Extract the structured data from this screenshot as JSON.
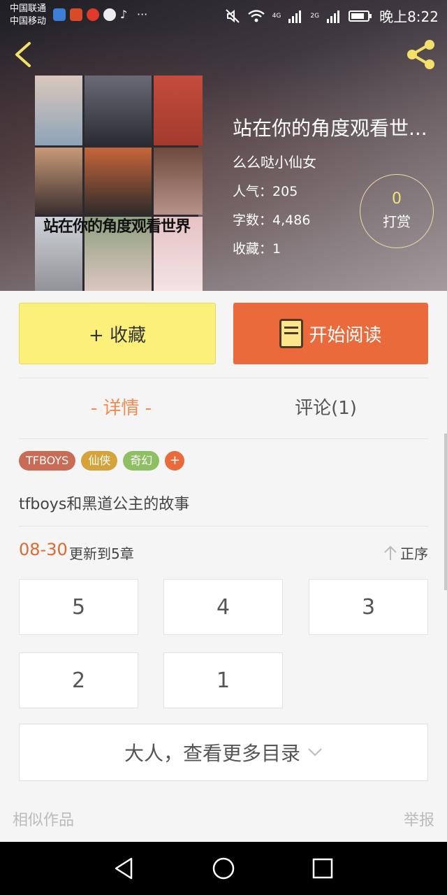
{
  "status_bar": {
    "carrier_1": "中国联通",
    "carrier_2": "中国移动",
    "more_dots": "···",
    "network_1": "4G",
    "network_2": "2G",
    "time": "晚上8:22"
  },
  "book": {
    "cover_title": "站在你的角度观看世界",
    "title": "站在你的角度观看世...",
    "author": "么么哒小仙女",
    "popularity_label": "人气：",
    "popularity_value": "205",
    "words_label": "字数：",
    "words_value": "4,486",
    "favorites_label": "收藏：",
    "favorites_value": "1",
    "tip_count": "0",
    "tip_label": "打赏"
  },
  "actions": {
    "collect_label": "+ 收藏",
    "read_label": "开始阅读"
  },
  "tabs": [
    {
      "label": "- 详情 -",
      "active": true
    },
    {
      "label": "评论(1)",
      "active": false
    }
  ],
  "tags": [
    {
      "label": "TFBOYS",
      "color": "#c96b55"
    },
    {
      "label": "仙侠",
      "color": "#d6a23a"
    },
    {
      "label": "奇幻",
      "color": "#8fbf63"
    }
  ],
  "tag_add": "+",
  "description": "tfboys和黑道公主的故事",
  "update": {
    "date": "08-30",
    "text": "更新到5章",
    "sort_label": "正序"
  },
  "chapters": [
    "5",
    "4",
    "3",
    "2",
    "1"
  ],
  "more_label": "大人，查看更多目录",
  "footer": {
    "similar": "相似作品",
    "report": "举报"
  },
  "colors": {
    "accent": "#ea6a3b",
    "collect_bg": "#fdf07a",
    "tab_active": "#f08a50"
  }
}
